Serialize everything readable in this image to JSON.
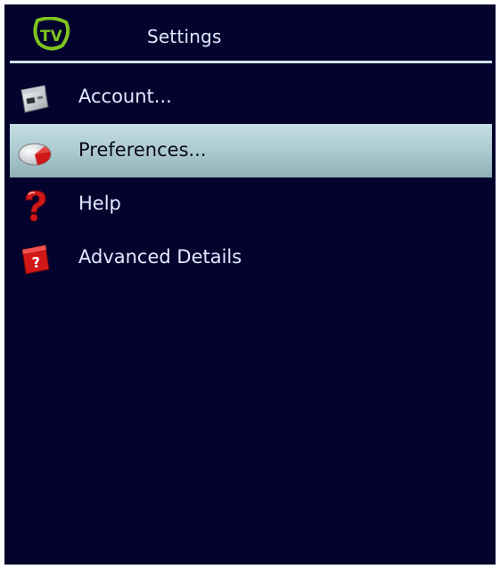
{
  "header": {
    "logo_text": "TV",
    "title": "Settings"
  },
  "menu": {
    "items": [
      {
        "label": "Account...",
        "icon": "account-icon",
        "selected": false
      },
      {
        "label": "Preferences...",
        "icon": "preferences-icon",
        "selected": true
      },
      {
        "label": "Help",
        "icon": "help-icon",
        "selected": false
      },
      {
        "label": "Advanced Details",
        "icon": "advanced-details-icon",
        "selected": false
      }
    ]
  },
  "colors": {
    "background": "#03032e",
    "highlight": "#a9c8cd",
    "logo_green": "#7fc41f",
    "icon_red": "#d11818"
  }
}
